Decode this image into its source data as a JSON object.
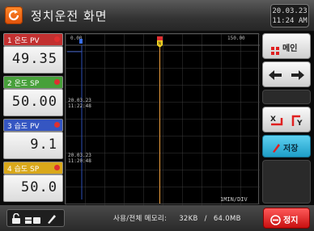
{
  "title": "정치운전 화면",
  "clock": {
    "date": "20.03.23",
    "time": "11:24 AM"
  },
  "channels": [
    {
      "label": "1 온도 PV",
      "value": "49.35",
      "color": "#d23a3a"
    },
    {
      "label": "2 온도 SP",
      "value": "50.00",
      "color": "#4caf3c"
    },
    {
      "label": "3 습도 PV",
      "value": "9.1",
      "color": "#3a5fcf"
    },
    {
      "label": "4 습도 SP",
      "value": "50.0",
      "color": "#e0b020"
    }
  ],
  "chart": {
    "scale_left": "0.00",
    "scale_right": "150.00",
    "cursor_marker": "N",
    "time_marks": [
      {
        "date": "20.03.23",
        "time": "11:22:48"
      },
      {
        "date": "20.03.23",
        "time": "11:20:48"
      }
    ],
    "div_label": "1MIN/DIV"
  },
  "buttons": {
    "main": "메인",
    "save": "저장",
    "stop": "정지"
  },
  "memory": {
    "label": "사용/전체 메모리:",
    "used": "32KB",
    "sep": "/",
    "total": "64.0MB"
  },
  "colors": {
    "accent": "#ff6a13",
    "stop": "#d81e1e"
  }
}
